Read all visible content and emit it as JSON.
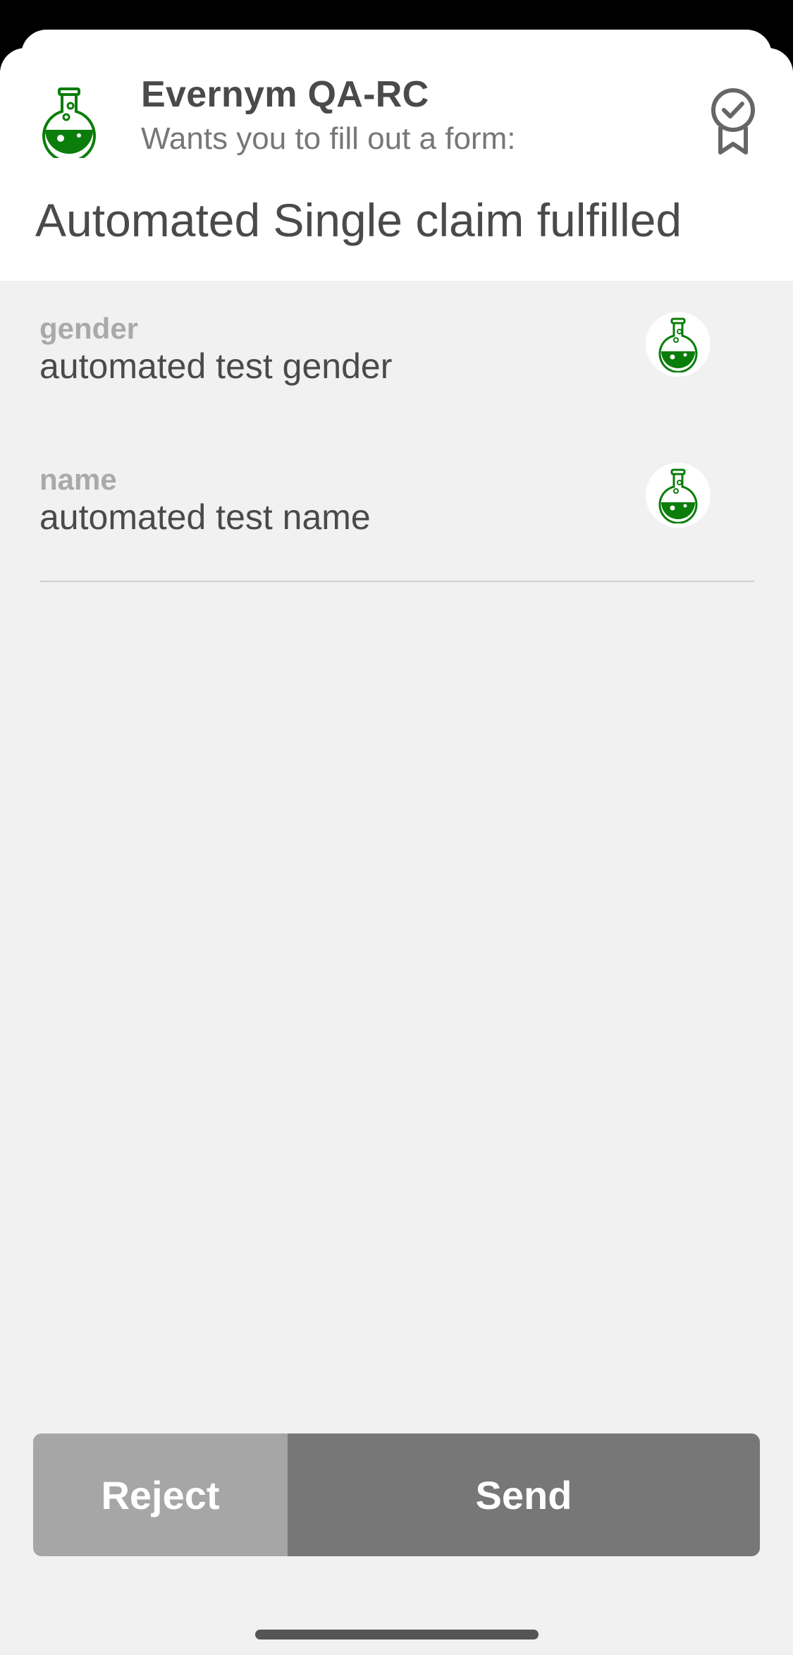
{
  "header": {
    "org_name": "Evernym QA-RC",
    "subtitle": "Wants you to fill out a form:",
    "form_title": "Automated Single claim fulfilled"
  },
  "attributes": [
    {
      "label": "gender",
      "value": "automated test gender",
      "icon": "flask-icon"
    },
    {
      "label": "name",
      "value": "automated test name",
      "icon": "flask-icon"
    }
  ],
  "actions": {
    "reject_label": "Reject",
    "send_label": "Send"
  },
  "colors": {
    "brand_green": "#0a7d0a",
    "reject_bg": "#a6a6a6",
    "send_bg": "#777777",
    "background": "#f1f1f1"
  }
}
